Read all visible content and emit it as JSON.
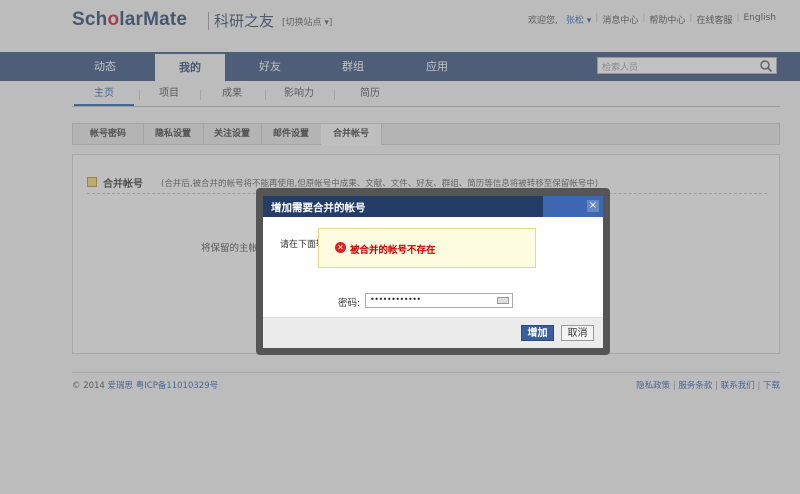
{
  "logo": {
    "part1": "Sch",
    "part2": "o",
    "part3": "larMate",
    "cn": "科研之友"
  },
  "header": {
    "switch_site": "[切换站点 ▾]",
    "welcome": "欢迎您,",
    "user": "张松 ▾",
    "links": [
      "消息中心",
      "帮助中心",
      "在线客服",
      "English"
    ]
  },
  "nav": {
    "items": [
      "动态",
      "我的",
      "好友",
      "群组",
      "应用"
    ],
    "active": "我的"
  },
  "search": {
    "placeholder": "检索人员"
  },
  "subnav": {
    "items": [
      "主页",
      "项目",
      "成果",
      "影响力",
      "简历"
    ]
  },
  "tabs": {
    "items": [
      "帐号密码",
      "隐私设置",
      "关注设置",
      "邮件设置",
      "合并帐号"
    ],
    "active": "合并帐号"
  },
  "content": {
    "section_title": "合并帐号",
    "section_desc": "(合并后,被合并的帐号将不能再使用,但原帐号中成果、文献、文件、好友、群组、简历等信息将被转移至保留帐号中)",
    "keep_label": "将保留的主帐号"
  },
  "dialog": {
    "title": "增加需要合并的帐号",
    "instruction": "请在下面输",
    "error_message": "被合并的帐号不存在",
    "password_label": "密码:",
    "password_value": "••••••••••••",
    "add_button": "增加",
    "cancel_button": "取消",
    "close": "×"
  },
  "footer": {
    "copyright": "© 2014",
    "company": "爱瑞思",
    "icp": "粤ICP备11010329号",
    "links": [
      "隐私政策",
      "服务条款",
      "联系我们",
      "下载"
    ]
  },
  "colors": {
    "nav_bg": "#2c4a78",
    "dialog_title_bg": "#243d66",
    "error_red": "#cc0000",
    "link": "#1e5aa8"
  }
}
